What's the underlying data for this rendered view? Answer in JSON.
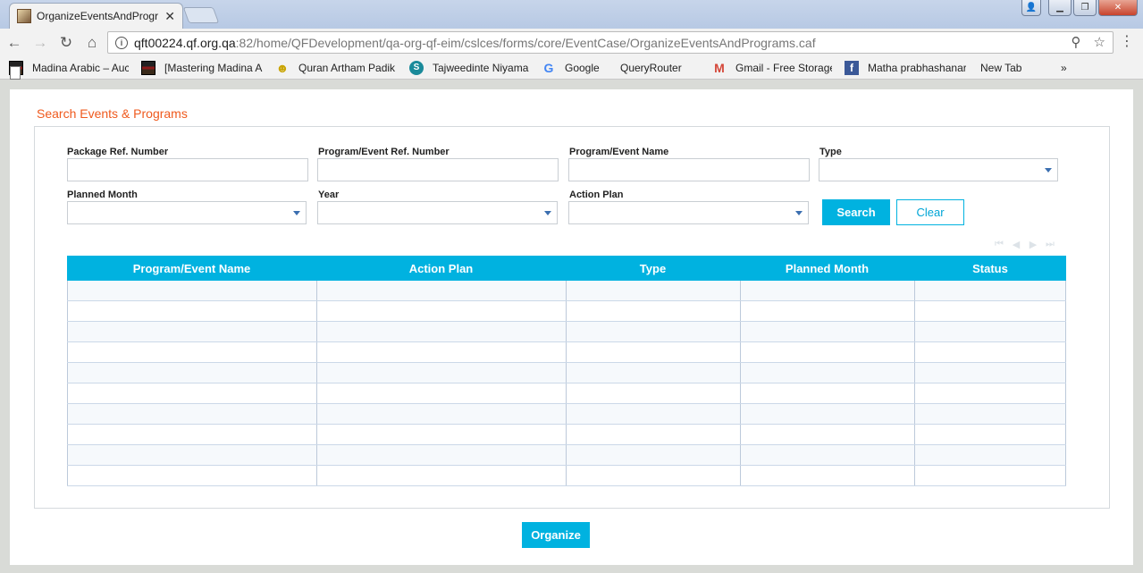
{
  "browser": {
    "tab_title": "OrganizeEventsAndProgr",
    "url_host": "qft00224.qf.org.qa",
    "url_path": ":82/home/QFDevelopment/qa-org-qf-eim/cslces/forms/core/EventCase/OrganizeEventsAndPrograms.caf",
    "bookmarks": [
      {
        "label": "Madina Arabic – Auc",
        "icon": "madina-icon"
      },
      {
        "label": "[Mastering Madina A",
        "icon": "madina-icon"
      },
      {
        "label": "Quran Artham Padik",
        "icon": "quran-icon"
      },
      {
        "label": "Tajweedinte Niyama",
        "icon": "tajweed-icon"
      },
      {
        "label": "Google",
        "icon": "google-icon"
      },
      {
        "label": "QueryRouter",
        "icon": "page-icon"
      },
      {
        "label": "Gmail - Free Storage",
        "icon": "gmail-icon"
      },
      {
        "label": "Matha prabhashanar",
        "icon": "facebook-icon"
      },
      {
        "label": "New Tab",
        "icon": "page-icon"
      }
    ]
  },
  "page": {
    "title": "Search Events & Programs",
    "filters": {
      "package_ref_label": "Package Ref. Number",
      "program_ref_label": "Program/Event Ref. Number",
      "program_name_label": "Program/Event Name",
      "type_label": "Type",
      "planned_month_label": "Planned Month",
      "year_label": "Year",
      "action_plan_label": "Action Plan",
      "package_ref_value": "",
      "program_ref_value": "",
      "program_name_value": "",
      "type_value": "",
      "planned_month_value": "",
      "year_value": "",
      "action_plan_value": ""
    },
    "search_label": "Search",
    "clear_label": "Clear",
    "organize_label": "Organize",
    "grid": {
      "columns": [
        "Program/Event Name",
        "Action Plan",
        "Type",
        "Planned Month",
        "Status"
      ],
      "rows": [
        [
          "",
          "",
          "",
          "",
          ""
        ],
        [
          "",
          "",
          "",
          "",
          ""
        ],
        [
          "",
          "",
          "",
          "",
          ""
        ],
        [
          "",
          "",
          "",
          "",
          ""
        ],
        [
          "",
          "",
          "",
          "",
          ""
        ],
        [
          "",
          "",
          "",
          "",
          ""
        ],
        [
          "",
          "",
          "",
          "",
          ""
        ],
        [
          "",
          "",
          "",
          "",
          ""
        ],
        [
          "",
          "",
          "",
          "",
          ""
        ],
        [
          "",
          "",
          "",
          "",
          ""
        ]
      ]
    }
  },
  "colors": {
    "accent": "#00b2e0",
    "title": "#ef5a1e"
  }
}
